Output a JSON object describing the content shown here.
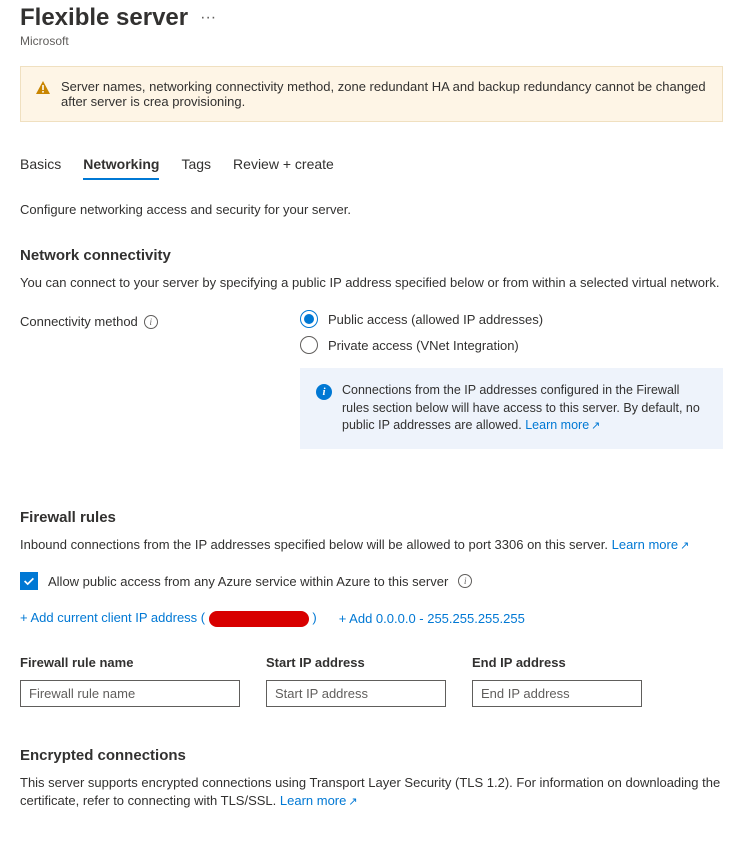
{
  "header": {
    "title": "Flexible server",
    "subtitle": "Microsoft"
  },
  "warning": "Server names, networking connectivity method, zone redundant HA and backup redundancy cannot be changed after server is crea provisioning.",
  "tabs": [
    {
      "label": "Basics",
      "active": false
    },
    {
      "label": "Networking",
      "active": true
    },
    {
      "label": "Tags",
      "active": false
    },
    {
      "label": "Review + create",
      "active": false
    }
  ],
  "intro": "Configure networking access and security for your server.",
  "network": {
    "heading": "Network connectivity",
    "desc": "You can connect to your server by specifying a public IP address specified below or from within a selected virtual network.",
    "label": "Connectivity method",
    "options": [
      {
        "label": "Public access (allowed IP addresses)",
        "selected": true
      },
      {
        "label": "Private access (VNet Integration)",
        "selected": false
      }
    ],
    "info": "Connections from the IP addresses configured in the Firewall rules section below will have access to this server. By default, no public IP addresses are allowed. ",
    "learn_more": "Learn more"
  },
  "firewall": {
    "heading": "Firewall rules",
    "desc_prefix": "Inbound connections from the IP addresses specified below will be allowed to port 3306 on this server. ",
    "learn_more": "Learn more",
    "checkbox_label": "Allow public access from any Azure service within Azure to this server",
    "add_client_prefix": "+ Add current client IP address ( ",
    "add_client_suffix": " )",
    "add_range": "+ Add 0.0.0.0 - 255.255.255.255",
    "columns": {
      "name": "Firewall rule name",
      "start": "Start IP address",
      "end": "End IP address"
    },
    "placeholders": {
      "name": "Firewall rule name",
      "start": "Start IP address",
      "end": "End IP address"
    }
  },
  "encrypted": {
    "heading": "Encrypted connections",
    "desc": "This server supports encrypted connections using Transport Layer Security (TLS 1.2). For information on downloading the certificate, refer to connecting with TLS/SSL. ",
    "learn_more": "Learn more"
  }
}
